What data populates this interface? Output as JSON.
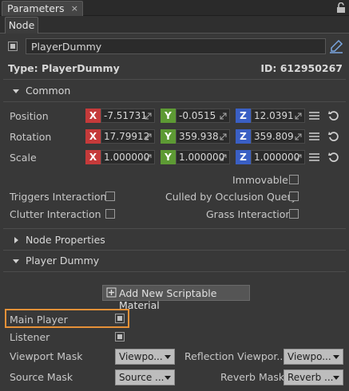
{
  "window": {
    "tab_title": "Parameters",
    "close_glyph": "×"
  },
  "subtab": {
    "label": "Node"
  },
  "node": {
    "name": "PlayerDummy",
    "type_text": "Type: PlayerDummy",
    "id_text": "ID: 612950267"
  },
  "common": {
    "title": "Common",
    "rows": [
      {
        "label": "Position",
        "x": "-7.51731",
        "y": "-0.0515",
        "z": "12.0391"
      },
      {
        "label": "Rotation",
        "x": "17.79912",
        "y": "359.938",
        "z": "359.809"
      },
      {
        "label": "Scale",
        "x": "1.000000",
        "y": "1.000000",
        "z": "1.000000"
      }
    ],
    "axis_letters": {
      "x": "X",
      "y": "Y",
      "z": "Z"
    },
    "immovable_label": "Immovable",
    "triggers_label": "Triggers Interaction",
    "culled_label": "Culled by Occlusion Query",
    "clutter_label": "Clutter Interaction",
    "grass_label": "Grass Interaction"
  },
  "node_properties": {
    "title": "Node Properties"
  },
  "player_dummy": {
    "title": "Player Dummy",
    "add_button_label": "Add New Scriptable Material",
    "main_player_label": "Main Player",
    "main_player_checked": true,
    "listener_label": "Listener",
    "listener_checked": true,
    "viewport_mask_label": "Viewport Mask",
    "viewport_mask_value": "Viewpo...",
    "reflection_mask_label": "Reflection Viewpor...",
    "reflection_mask_value": "Viewpo...",
    "source_mask_label": "Source Mask",
    "source_mask_value": "Source ...",
    "reverb_mask_label": "Reverb Mask",
    "reverb_mask_value": "Reverb ..."
  },
  "colors": {
    "x_axis": "#c53a3a",
    "y_axis": "#5d9a34",
    "z_axis": "#3a5fc4",
    "highlight": "#e69138"
  },
  "icons": [
    "lock-icon",
    "edit-icon",
    "list-menu-icon",
    "reset-icon",
    "plus-icon",
    "chevron-down-icon"
  ]
}
